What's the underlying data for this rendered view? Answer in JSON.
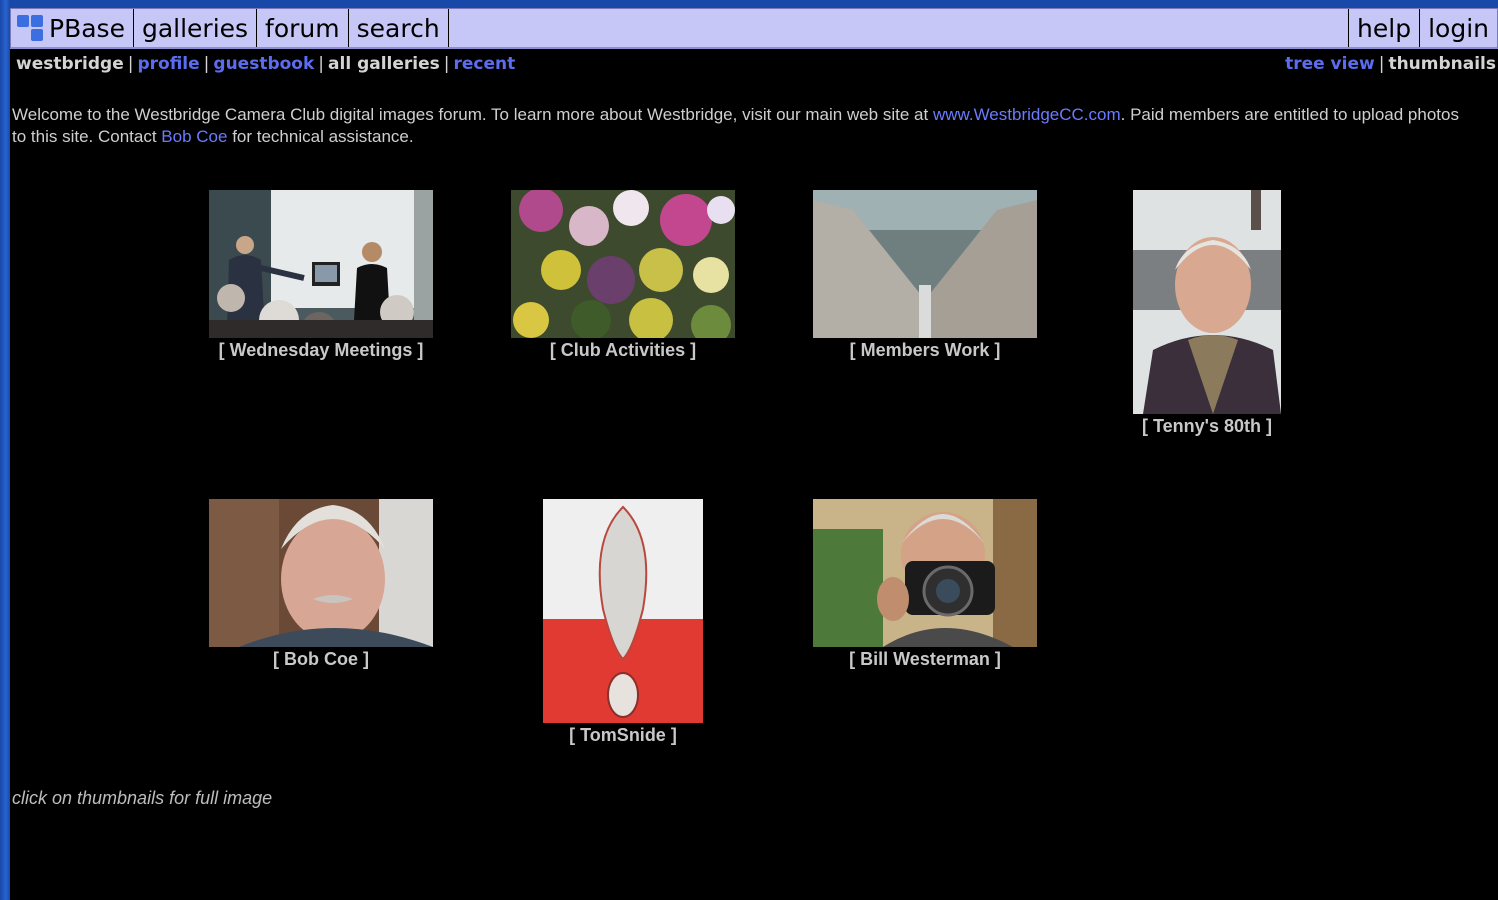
{
  "nav": {
    "brand": "PBase",
    "left_items": [
      "galleries",
      "forum",
      "search"
    ],
    "right_items": [
      "help",
      "login"
    ]
  },
  "subnav": {
    "user": "westbridge",
    "links": [
      "profile",
      "guestbook"
    ],
    "plain": "all galleries",
    "recent": "recent",
    "tree_view": "tree view",
    "thumbnails": "thumbnails"
  },
  "intro": {
    "text1": "Welcome to the Westbridge Camera Club digital images forum. To learn more about Westbridge, visit our main web site at ",
    "site_link": "www.WestbridgeCC.com",
    "text2": ". Paid members are entitled to upload photos to this site. Contact ",
    "contact_link": "Bob Coe",
    "text3": " for technical assistance."
  },
  "galleries": [
    {
      "caption": "[ Wednesday Meetings ]",
      "icon": "presentation-photo"
    },
    {
      "caption": "[ Club Activities ]",
      "icon": "flowers-photo"
    },
    {
      "caption": "[ Members Work ]",
      "icon": "abstract-photo"
    },
    {
      "caption": "[ Tenny's 80th ]",
      "icon": "portrait-photo"
    },
    {
      "caption": "[ Bob Coe ]",
      "icon": "portrait-photo"
    },
    {
      "caption": "[ TomSnide ]",
      "icon": "droplet-photo"
    },
    {
      "caption": "[ Bill Westerman ]",
      "icon": "camera-selfie-photo"
    }
  ],
  "footer": {
    "note": "click on thumbnails for full image"
  }
}
